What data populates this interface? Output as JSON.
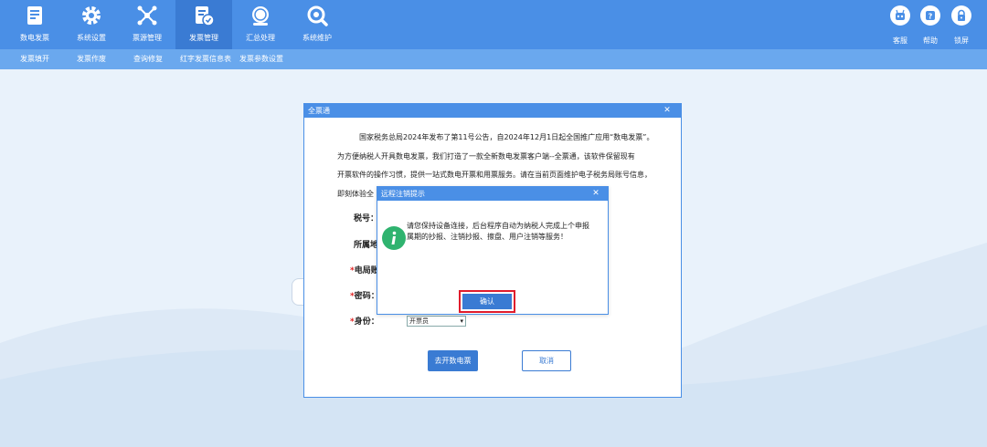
{
  "topnav": {
    "items": [
      {
        "label": "数电发票",
        "icon": "invoice-icon"
      },
      {
        "label": "系统设置",
        "icon": "gear-icon"
      },
      {
        "label": "票源管理",
        "icon": "network-icon"
      },
      {
        "label": "发票管理",
        "icon": "invoice-manage-icon"
      },
      {
        "label": "汇总处理",
        "icon": "tax-summary-icon"
      },
      {
        "label": "系统维护",
        "icon": "maintenance-icon"
      }
    ],
    "active_index": 3,
    "right_items": [
      {
        "label": "客服",
        "icon": "robot-icon"
      },
      {
        "label": "帮助",
        "icon": "help-icon"
      },
      {
        "label": "锁屏",
        "icon": "lock-icon"
      }
    ]
  },
  "subnav": {
    "items": [
      "发票填开",
      "发票作废",
      "查询修复",
      "红字发票信息表",
      "发票参数设置"
    ]
  },
  "dialog": {
    "title": "全票通",
    "close": "✕",
    "paragraphs": [
      "国家税务总局2024年发布了第11号公告，自2024年12月1日起全国推广应用“数电发票”。",
      "为方便纳税人开具数电发票，我们打造了一款全新数电发票客户端--全票通，该软件保留现有",
      "开票软件的操作习惯，提供一站式数电开票和用票服务。请在当前页面维护电子税务局账号信息，",
      "即刻体验全"
    ],
    "labels": {
      "tax_no": "税号：",
      "region": "所属地",
      "account": "电局账",
      "password": "密码：",
      "identity": "身份："
    },
    "identity_value": "开票员",
    "submit_label": "去开数电票",
    "cancel_label": "取消"
  },
  "modal": {
    "title": "远程注销提示",
    "close": "✕",
    "message_lines": [
      "请您保持设备连接，后台程序自动为纳税人完成上个申报",
      "属期的抄报、注销抄报、擦盘、用户注销等服务！"
    ],
    "confirm_label": "确认"
  },
  "colors": {
    "topbar": "#4a8fe6",
    "subbar": "#6aa8ee",
    "primary": "#3a7bd3",
    "highlight": "#e01c2c",
    "info": "#2fb36f"
  }
}
